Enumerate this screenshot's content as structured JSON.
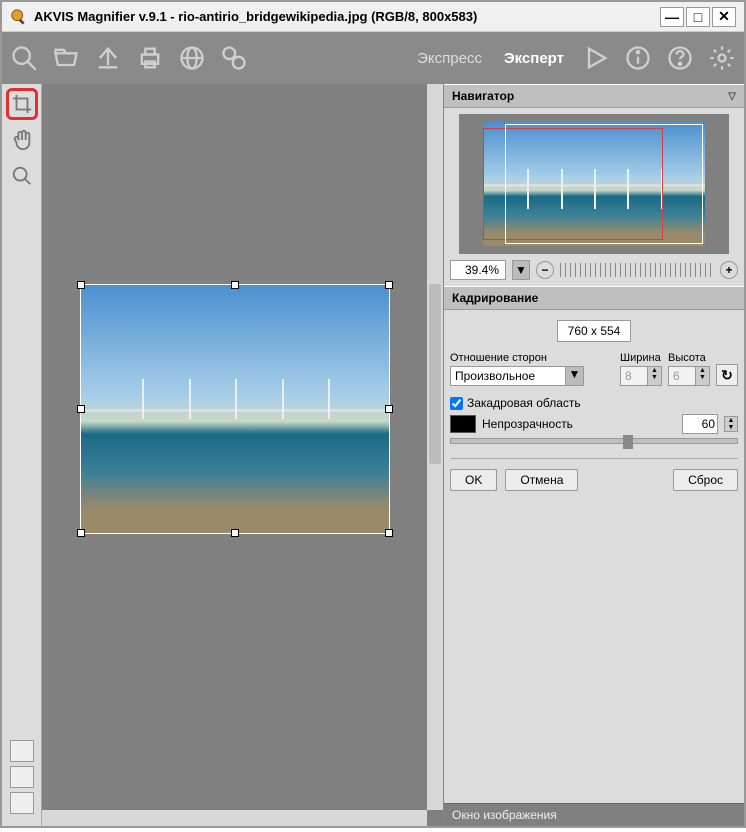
{
  "title": "AKVIS Magnifier v.9.1 - rio-antirio_bridgewikipedia.jpg (RGB/8, 800x583)",
  "modes": {
    "express": "Экспресс",
    "expert": "Эксперт"
  },
  "navigator": {
    "title": "Навигатор",
    "zoom": "39.4%"
  },
  "crop": {
    "title": "Кадрирование",
    "dimensions": "760 x 554",
    "ratio_label": "Отношение сторон",
    "ratio_value": "Произвольное",
    "width_label": "Ширина",
    "width_value": "8",
    "height_label": "Высота",
    "height_value": "6",
    "offscreen_label": "Закадровая область",
    "opacity_label": "Непрозрачность",
    "opacity_value": "60",
    "ok": "OK",
    "cancel": "Отмена",
    "reset": "Сброс"
  },
  "status": "Окно изображения"
}
